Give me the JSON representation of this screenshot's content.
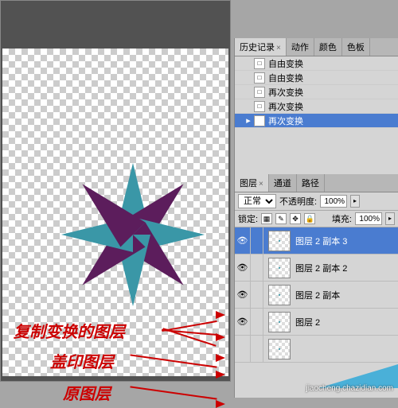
{
  "annotations": {
    "copy_transform_layer": "复制变换的图层",
    "stamp_layer": "盖印图层",
    "original_layer": "原图层"
  },
  "history_panel": {
    "tabs": [
      "历史记录",
      "动作",
      "颜色",
      "色板"
    ],
    "active_tab": 0,
    "items": [
      {
        "label": "自由变换",
        "current": false
      },
      {
        "label": "自由变换",
        "current": false
      },
      {
        "label": "再次变换",
        "current": false
      },
      {
        "label": "再次变换",
        "current": false
      },
      {
        "label": "再次变换",
        "current": true
      }
    ]
  },
  "layers_panel": {
    "tabs": [
      "图层",
      "通道",
      "路径"
    ],
    "active_tab": 0,
    "blend_mode": "正常",
    "opacity_label": "不透明度:",
    "opacity_value": "100%",
    "lock_label": "锁定:",
    "fill_label": "填充:",
    "fill_value": "100%",
    "layers": [
      {
        "name": "图层 2 副本 3",
        "visible": true,
        "selected": true
      },
      {
        "name": "图层 2 副本 2",
        "visible": true,
        "selected": false
      },
      {
        "name": "图层 2 副本",
        "visible": true,
        "selected": false
      },
      {
        "name": "图层 2",
        "visible": true,
        "selected": false
      },
      {
        "name": "",
        "visible": false,
        "selected": false
      }
    ]
  },
  "watermark": "jiaocheng.chazidian.com"
}
